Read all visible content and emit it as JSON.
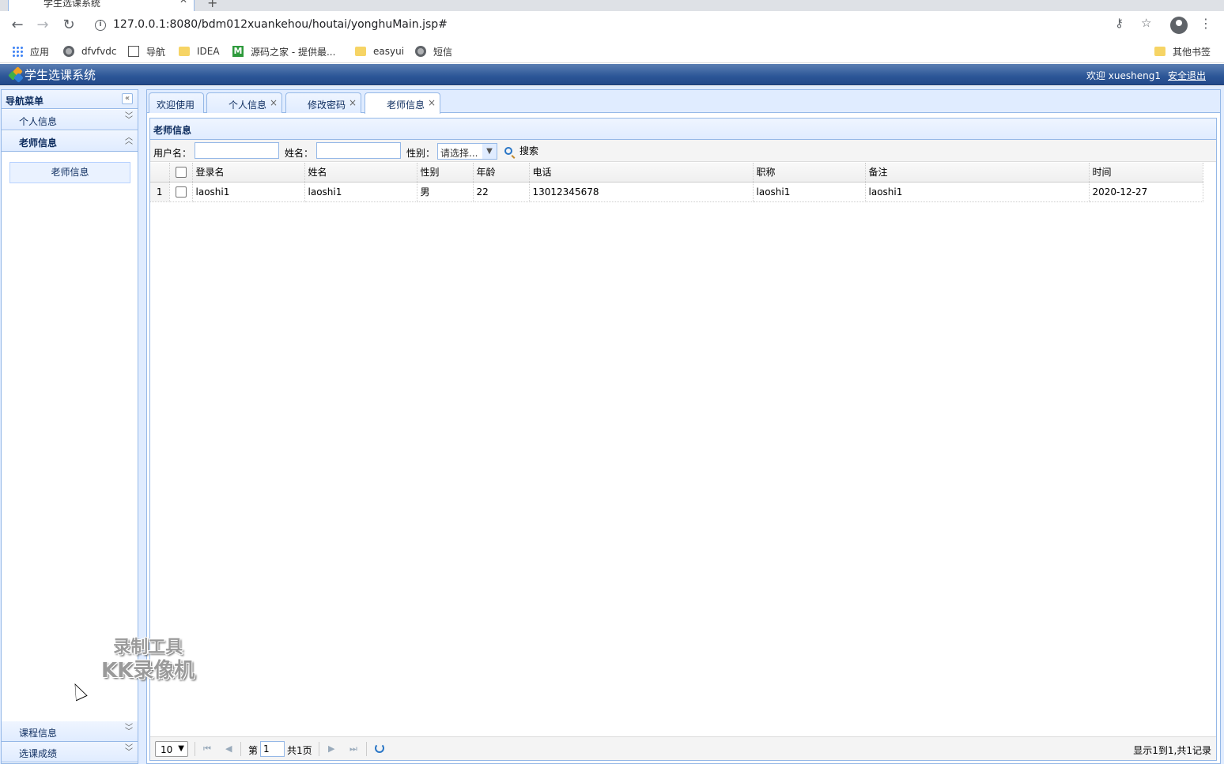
{
  "browser": {
    "tab_title": "学生选课系统",
    "url": "127.0.0.1:8080/bdm012xuankehou/houtai/yonghuMain.jsp#",
    "bookmarks": [
      {
        "label": "应用",
        "icon": "apps-icon"
      },
      {
        "label": "dfvfvdc",
        "icon": "globe-icon"
      },
      {
        "label": "导航",
        "icon": "chart-icon"
      },
      {
        "label": "IDEA",
        "icon": "folder-icon"
      },
      {
        "label": "源码之家 - 提供最...",
        "icon": "m-logo-icon"
      },
      {
        "label": "easyui",
        "icon": "folder-icon"
      },
      {
        "label": "短信",
        "icon": "globe-icon"
      }
    ],
    "other_bookmarks": "其他书签"
  },
  "app": {
    "title": "学生选课系统",
    "welcome": "欢迎 xuesheng1",
    "logout": "安全退出"
  },
  "sidebar": {
    "title": "导航菜单",
    "sections": [
      {
        "label": "个人信息",
        "expanded": false
      },
      {
        "label": "老师信息",
        "expanded": true,
        "items": [
          "老师信息"
        ]
      },
      {
        "label": "课程信息",
        "expanded": false
      },
      {
        "label": "选课成绩",
        "expanded": false
      }
    ]
  },
  "tabs": [
    {
      "label": "欢迎使用",
      "closable": false
    },
    {
      "label": "个人信息",
      "closable": true
    },
    {
      "label": "修改密码",
      "closable": true
    },
    {
      "label": "老师信息",
      "closable": true,
      "active": true
    }
  ],
  "tab_close_glyph": "×",
  "panel": {
    "title": "老师信息",
    "search": {
      "username_label": "用户名：",
      "username_value": "",
      "name_label": "姓名：",
      "name_value": "",
      "gender_label": "性别：",
      "gender_selected": "请选择...",
      "search_button": "搜索"
    },
    "columns": [
      "登录名",
      "姓名",
      "性别",
      "年龄",
      "电话",
      "职称",
      "备注",
      "时间"
    ],
    "rows": [
      {
        "num": "1",
        "cells": [
          "laoshi1",
          "laoshi1",
          "男",
          "22",
          "13012345678",
          "laoshi1",
          "laoshi1",
          "2020-12-27"
        ]
      }
    ],
    "pager": {
      "page_size": "10",
      "page_prefix": "第",
      "page_number": "1",
      "page_total": "共1页",
      "info": "显示1到1,共1记录"
    }
  },
  "watermark": {
    "line1": "录制工具",
    "line2": "KK录像机"
  },
  "colors": {
    "header_blue": "#2c5697",
    "border_blue": "#95b8e7",
    "panel_bg": "#e0ecff"
  }
}
